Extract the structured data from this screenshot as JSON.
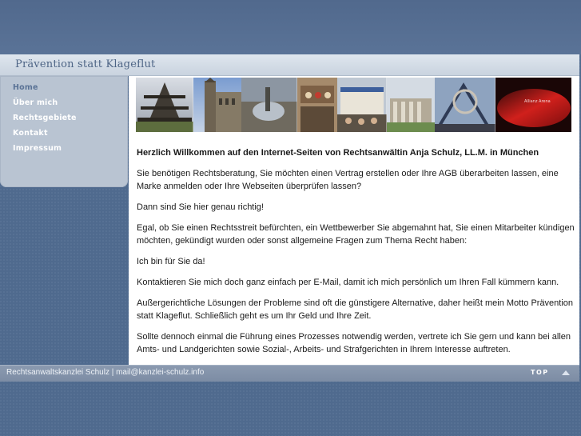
{
  "site": {
    "title": "Prävention statt Klageflut"
  },
  "nav": {
    "items": [
      {
        "label": "Home"
      },
      {
        "label": "Über mich"
      },
      {
        "label": "Rechtsgebiete"
      },
      {
        "label": "Kontakt"
      },
      {
        "label": "Impressum"
      }
    ]
  },
  "content": {
    "welcome": "Herzlich Willkommen auf den Internet-Seiten von Rechtsanwältin Anja Schulz, LL.M. in München",
    "paragraphs": [
      "Sie benötigen Rechtsberatung, Sie möchten einen Vertrag erstellen oder Ihre AGB überarbeiten lassen, eine Marke anmelden oder Ihre Webseiten überprüfen lassen?",
      "Dann sind Sie hier genau  richtig!",
      "Egal, ob Sie einen Rechtsstreit befürchten, ein Wettbewerber Sie abgemahnt hat, Sie einen Mitarbeiter kündigen möchten, gekündigt wurden oder sonst allgemeine Fragen zum Thema Recht haben:",
      "Ich bin für Sie da!",
      "Kontaktieren Sie mich doch ganz einfach per E-Mail, damit ich mich persönlich um Ihren Fall kümmern kann.",
      "Außergerichtliche Lösungen der Probleme sind oft die günstigere Alternative, daher heißt mein Motto Prävention statt Klageflut. Schließlich geht es um Ihr Geld und Ihre Zeit.",
      "Sollte dennoch einmal die Führung eines Prozesses notwendig werden, vertrete ich Sie gern und kann bei allen Amts- und Landgerichten sowie Sozial-, Arbeits- und Strafgerichten in Ihrem Interesse auftreten."
    ]
  },
  "banner": {
    "stadium_sign": "Allianz Arena"
  },
  "footer": {
    "left": "Rechtsanwaltskanzlei Schulz | mail@kanzlei-schulz.info",
    "top_label": "TOP",
    "top_icon": "arrow-up-icon"
  },
  "colors": {
    "background": "#4f6a8e",
    "header": "#d6dee8",
    "sidebar": "#b9c4d2",
    "nav_active": "#5b7396",
    "footer": "#8393aa"
  }
}
